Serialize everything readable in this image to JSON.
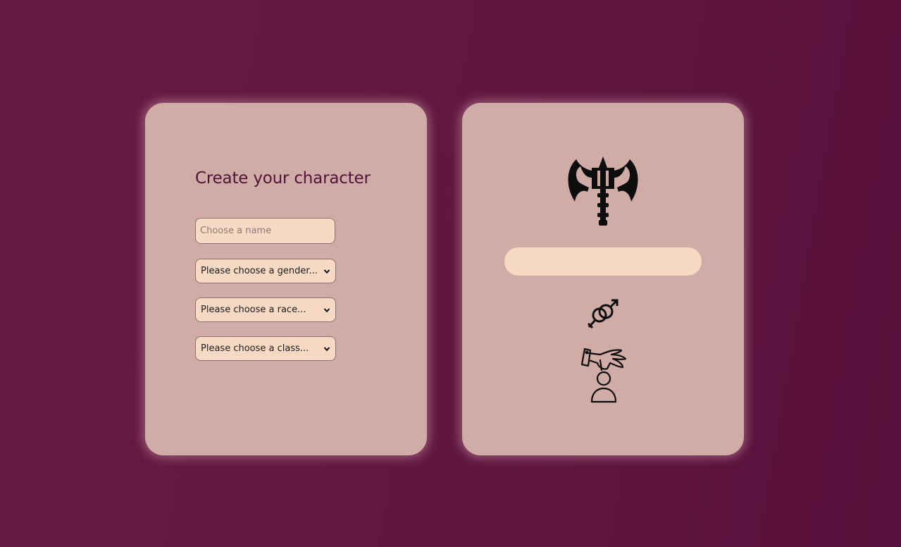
{
  "form": {
    "title": "Create your character",
    "name_input": {
      "value": "",
      "placeholder": "Choose a name"
    },
    "gender_select": {
      "selected": "Please choose a gender..."
    },
    "race_select": {
      "selected": "Please choose a race..."
    },
    "class_select": {
      "selected": "Please choose a class..."
    }
  },
  "preview": {
    "name": "",
    "icons": [
      "battle-axe-icon",
      "gender-symbol-icon",
      "class-figure-icon"
    ]
  },
  "colors": {
    "background": "#5f1640",
    "card": "#d1aba5",
    "field": "#f7d9c4",
    "title": "#4f1438"
  }
}
